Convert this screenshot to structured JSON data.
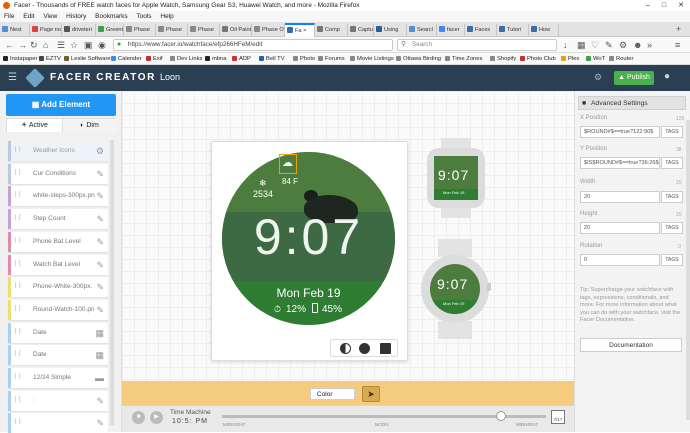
{
  "window": {
    "title": "Facer - Thousands of FREE watch faces for Apple Watch, Samsung Gear S3, Huawei Watch, and more - Mozilla Firefox"
  },
  "menu": [
    "File",
    "Edit",
    "View",
    "History",
    "Bookmarks",
    "Tools",
    "Help"
  ],
  "tabs": [
    {
      "label": "Nest",
      "color": "#4a90d9"
    },
    {
      "label": "Page not",
      "color": "#e04040"
    },
    {
      "label": "driveteri",
      "color": "#555555"
    },
    {
      "label": "Greent",
      "color": "#3aa04a"
    },
    {
      "label": "Phase",
      "color": "#888888"
    },
    {
      "label": "Phase",
      "color": "#888888"
    },
    {
      "label": "Phase",
      "color": "#888888"
    },
    {
      "label": "Oil Paintir",
      "color": "#777777"
    },
    {
      "label": "Phase ON",
      "color": "#888888"
    },
    {
      "label": "Fa ×",
      "color": "#3a6ea5",
      "active": true
    },
    {
      "label": "Comp",
      "color": "#777777"
    },
    {
      "label": "Captu",
      "color": "#777777"
    },
    {
      "label": "Using",
      "color": "#2a5d9a"
    },
    {
      "label": "Searcl",
      "color": "#4a90d9"
    },
    {
      "label": "facer",
      "color": "#4285f4"
    },
    {
      "label": "Faces",
      "color": "#3a6ea5"
    },
    {
      "label": "Tutori",
      "color": "#3a6ea5"
    },
    {
      "label": "How",
      "color": "#3a6ea5"
    }
  ],
  "url": "https://www.facer.io/watchface/efp266HFeM/edit",
  "search_placeholder": "Search",
  "bookmarks": [
    {
      "label": "Instapaper",
      "color": "#222222"
    },
    {
      "label": "EZTV",
      "color": "#444444"
    },
    {
      "label": "Leslie Software",
      "color": "#7a5a2a"
    },
    {
      "label": "Calender",
      "color": "#4285f4"
    },
    {
      "label": "Exif",
      "color": "#c03030"
    },
    {
      "label": "Dev Links",
      "color": "#888888"
    },
    {
      "label": "mbna",
      "color": "#222222"
    },
    {
      "label": "ADP",
      "color": "#d03030"
    },
    {
      "label": "Bell TV",
      "color": "#2060b0"
    },
    {
      "label": "Photo",
      "color": "#888888"
    },
    {
      "label": "Forums",
      "color": "#888888"
    },
    {
      "label": "Movie Listings",
      "color": "#888888"
    },
    {
      "label": "Ottawa Birding",
      "color": "#888888"
    },
    {
      "label": "Time Zones",
      "color": "#888888"
    },
    {
      "label": "Shopify",
      "color": "#888888"
    },
    {
      "label": "Photo Club",
      "color": "#c03030"
    },
    {
      "label": "Plex",
      "color": "#e5a00d"
    },
    {
      "label": "WoT",
      "color": "#3aa04a"
    },
    {
      "label": "Router",
      "color": "#888888"
    }
  ],
  "app": {
    "brand": "FACER CREATOR",
    "face_name": "Loon",
    "publish": "Publish",
    "accent": "#2196f3",
    "header_bg": "#2b3f53"
  },
  "left": {
    "add_element": "Add Element",
    "tab_active": "Active",
    "tab_dim": "Dim",
    "layers": [
      {
        "label": "Weather Icons",
        "icon": "gear-icon",
        "color": "#b7c8e0",
        "selected": true
      },
      {
        "label": "Cur Conditions",
        "icon": "pencil-icon",
        "color": "#b7c8e0"
      },
      {
        "label": "white-steps-300px.pn",
        "icon": "pencil-icon",
        "color": "#c8a0d8"
      },
      {
        "label": "Step Count",
        "icon": "pencil-icon",
        "color": "#c8a0d8"
      },
      {
        "label": "Phone Bat Level",
        "icon": "pencil-icon",
        "color": "#e08ab0"
      },
      {
        "label": "Watch Bat Level",
        "icon": "pencil-icon",
        "color": "#e08ab0"
      },
      {
        "label": "Phone-White-300px.",
        "icon": "pencil-icon",
        "color": "#e8e070"
      },
      {
        "label": "Round-Watch-100.pn",
        "icon": "pencil-icon",
        "color": "#e8e070"
      },
      {
        "label": "Date",
        "icon": "calendar-icon",
        "color": "#a8d0f0"
      },
      {
        "label": "Date",
        "icon": "calendar-icon",
        "color": "#a8d0f0"
      },
      {
        "label": "12/24 Simple",
        "icon": "rect-icon",
        "color": "#a8d0f0"
      },
      {
        "label": ":",
        "icon": "pencil-icon",
        "color": "#a8d0f0"
      },
      {
        "label": "",
        "icon": "pencil-icon",
        "color": "#a8d0f0"
      }
    ]
  },
  "watch": {
    "weather_temp": "84 F",
    "steps": "2534",
    "time": "9:07",
    "date": "Mon Feb 19",
    "watch_battery": "12%",
    "phone_battery": "45%"
  },
  "previews": {
    "square_time": "9:07",
    "square_date": "Mon Feb 19",
    "round_time": "9:07",
    "round_date": "Mon Feb 19"
  },
  "bottom": {
    "color_label": "Color",
    "time_machine": "Time Machine",
    "time_machine_value": "10:5: PM",
    "ticks": [
      "MIDNIGHT",
      "NOON",
      "MIDNIGHT"
    ],
    "calendar_day": "7/17",
    "slider_fraction": 0.86
  },
  "right": {
    "panel_title": "Advanced Settings",
    "x_label": "X Position",
    "x_value_hint": "125",
    "x_input": "$ROUND#$==true?122:90$",
    "y_label": "Y Position",
    "y_value_hint": "38",
    "y_input": "$IS$ROUND#$==true?36:26$",
    "width_label": "Width",
    "width_hint": "20",
    "width_input": "20",
    "height_label": "Height",
    "height_hint": "20",
    "height_input": "20",
    "rotation_label": "Rotation",
    "rotation_hint": "0",
    "rotation_input": "0",
    "tags_label": "TAGS",
    "tip": "Tip: Supercharge your watchface with tags, expressions, conditionals, and more. For more information about what you can do with your watchface, visit the Facer Documentation.",
    "doc_button": "Documentation"
  }
}
